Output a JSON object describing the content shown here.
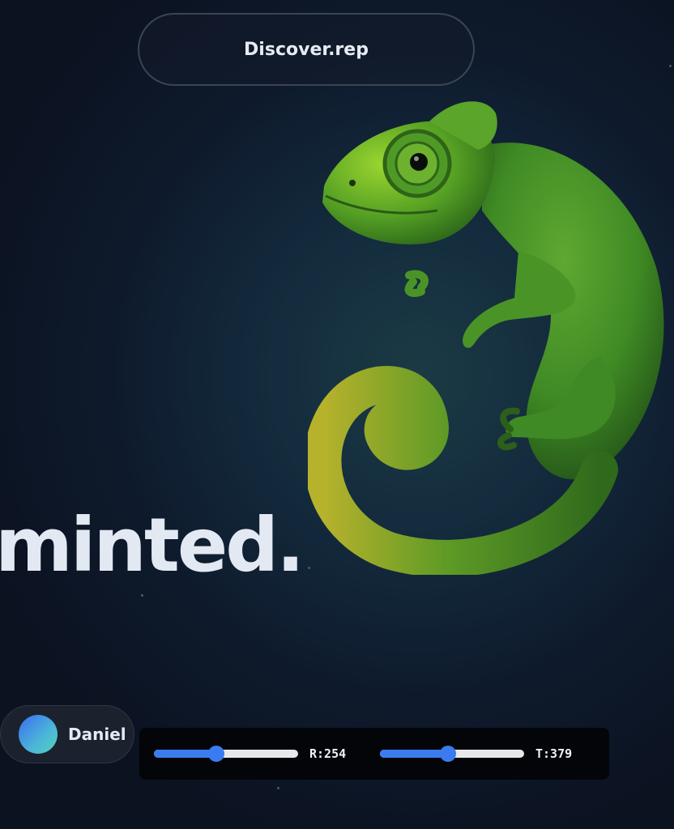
{
  "header": {
    "pill_label": "Discover.rep"
  },
  "hero": {
    "headline": "minted."
  },
  "illustration": {
    "name": "chameleon",
    "colors": {
      "body": "#3f8a24",
      "highlight": "#8ccf2c",
      "shadow": "#1f4a16"
    }
  },
  "user": {
    "name": "Daniel"
  },
  "controls": {
    "slider_r": {
      "label": "R:254",
      "fraction": 0.43
    },
    "slider_t": {
      "label": "T:379",
      "fraction": 0.47
    },
    "accent": "#3b7bf0"
  }
}
